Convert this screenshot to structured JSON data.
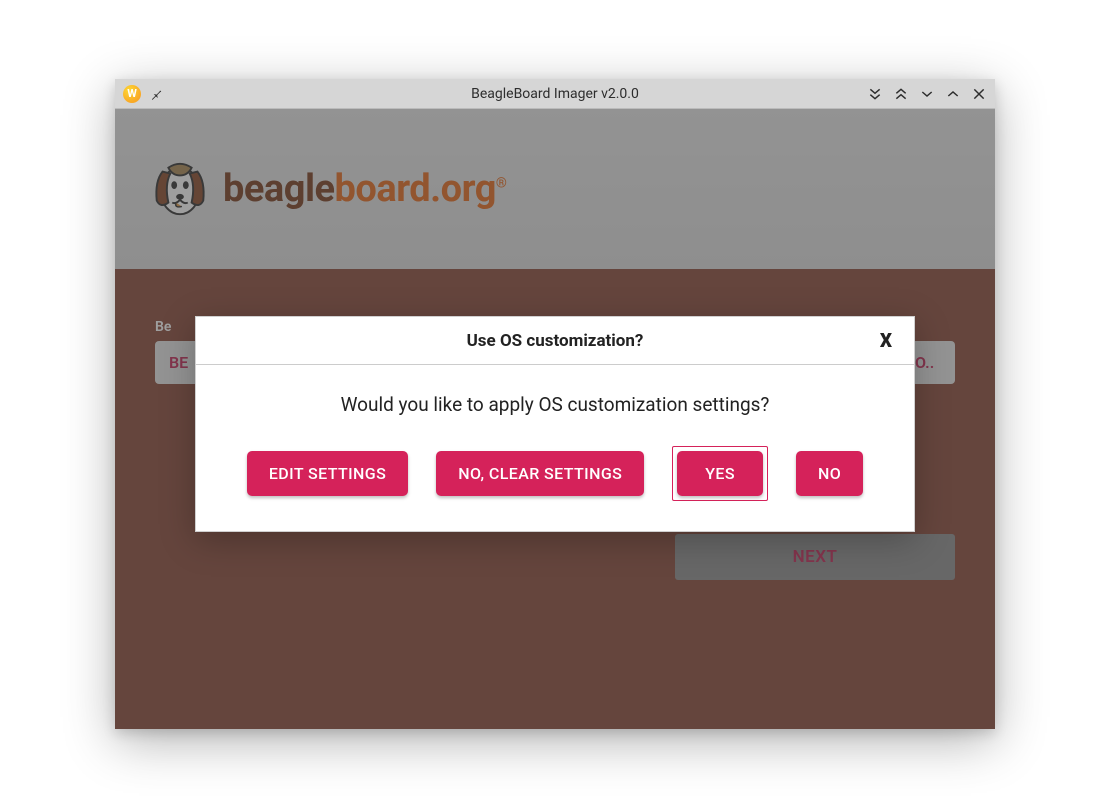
{
  "titlebar": {
    "title": "BeagleBoard Imager v2.0.0"
  },
  "brand": {
    "part1": "beagle",
    "part2": "board",
    "part3": ".org",
    "reg": "®"
  },
  "main": {
    "device_label_prefix": "Be",
    "device_value_prefix": "BE",
    "os_value_suffix": "OO..",
    "next_label": "NEXT"
  },
  "dialog": {
    "title": "Use OS customization?",
    "close": "X",
    "question": "Would you like to apply OS customization settings?",
    "buttons": {
      "edit": "EDIT SETTINGS",
      "clear": "NO, CLEAR SETTINGS",
      "yes": "YES",
      "no": "NO"
    }
  },
  "colors": {
    "accent": "#d5225a",
    "bg_panel": "#8a4a3b",
    "brand_orange": "#e46a1f",
    "brand_brown": "#7b3f20"
  }
}
